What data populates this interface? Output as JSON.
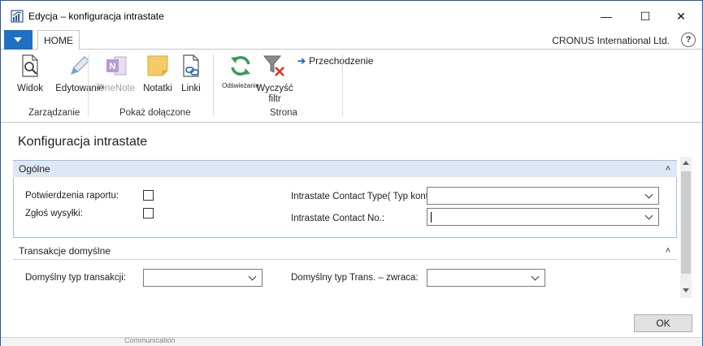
{
  "window": {
    "title": "Edycja – konfiguracja intrastate",
    "icon": "dynamics-nav-icon",
    "controls": {
      "minimize": "—",
      "maximize": "☐",
      "close": "✕"
    }
  },
  "ribbon": {
    "tab_home": "HOME",
    "company": "CRONUS International Ltd.",
    "help": "?",
    "buttons": {
      "view": "Widok",
      "edit": "Edytowanie",
      "onenote": "OneNote",
      "notes": "Notatki",
      "links": "Linki",
      "refresh": "Odświeżanie",
      "clear_filter": "Wyczyść filtr"
    },
    "groups": {
      "manage": "Zarządzanie",
      "show_attached": "Pokaż dołączone",
      "page": "Strona"
    },
    "small_actions": {
      "navigate": "Przechodzenie"
    }
  },
  "page": {
    "title": "Konfiguracja intrastate",
    "sections": {
      "general": {
        "header": "Ogólne",
        "fields": {
          "report_receipts": "Potwierdzenia raportu:",
          "shipments_report": "Zgłoś wysyłki:",
          "contact_type": "Intrastate Contact Type( Typ kontaktu intrastate):",
          "contact_no": "Intrastate Contact No.:"
        },
        "values": {
          "report_receipts_checked": false,
          "shipments_report_checked": false,
          "contact_type": "",
          "contact_no": ""
        }
      },
      "default_transactions": {
        "header": "Transakcje domyślne",
        "fields": {
          "default_transaction_type": "Domyślny typ transakcji:",
          "default_trans_return": "Domyślny typ Trans. – zwraca:"
        },
        "values": {
          "default_transaction_type": "",
          "default_trans_return": ""
        }
      }
    },
    "collapse_glyph": "˄"
  },
  "footer": {
    "ok": "OK",
    "background_text": "Communication"
  },
  "colors": {
    "accent": "#1f6fc5",
    "section_header": "#dde8f5",
    "section_border": "#9cbde5",
    "onenote": "#8e5bab",
    "refresh": "#3a9a5e",
    "clear": "#d9342b"
  }
}
